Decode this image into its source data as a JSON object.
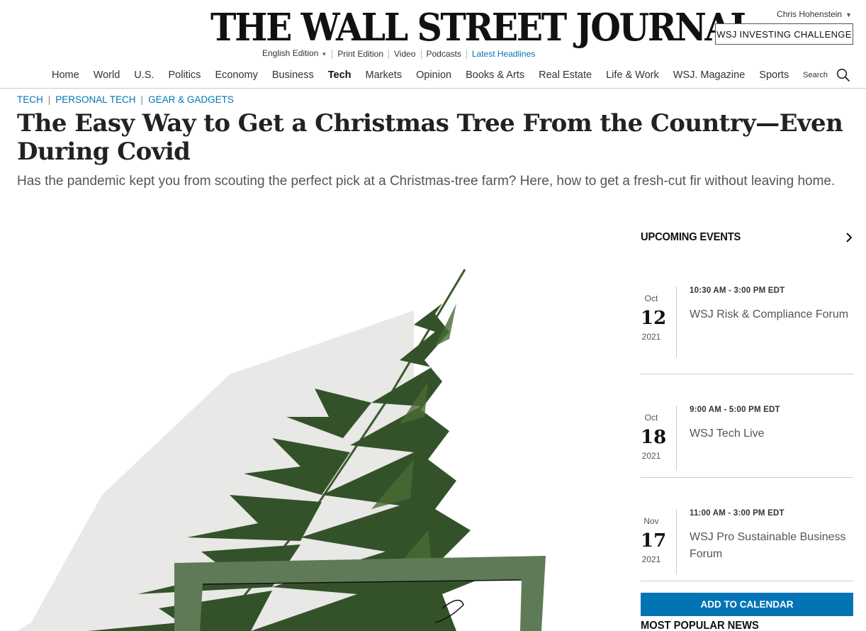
{
  "masthead": {
    "logo": "THE WALL STREET JOURNAL.",
    "user_name": "Chris Hohenstein",
    "challenge_label": "WSJ INVESTING CHALLENGE",
    "subnav": [
      "English Edition",
      "Print Edition",
      "Video",
      "Podcasts",
      "Latest Headlines"
    ]
  },
  "nav": {
    "items": [
      "Home",
      "World",
      "U.S.",
      "Politics",
      "Economy",
      "Business",
      "Tech",
      "Markets",
      "Opinion",
      "Books & Arts",
      "Real Estate",
      "Life & Work",
      "WSJ. Magazine",
      "Sports"
    ],
    "active": "Tech",
    "search_label": "Search"
  },
  "article": {
    "breadcrumbs": [
      "TECH",
      "PERSONAL TECH",
      "GEAR & GADGETS"
    ],
    "headline": "The Easy Way to Get a Christmas Tree From the Country—Even During Covid",
    "dek": "Has the pandemic kept you from scouting the perfect pick at a Christmas-tree farm? Here, how to get a fresh-cut fir without leaving home."
  },
  "rail": {
    "title": "UPCOMING EVENTS",
    "events": [
      {
        "month": "Oct",
        "day": "12",
        "year": "2021",
        "time": "10:30 AM - 3:00 PM EDT",
        "name": "WSJ Risk & Compliance Forum"
      },
      {
        "month": "Oct",
        "day": "18",
        "year": "2021",
        "time": "9:00 AM - 5:00 PM EDT",
        "name": "WSJ Tech Live"
      },
      {
        "month": "Nov",
        "day": "17",
        "year": "2021",
        "time": "11:00 AM - 3:00 PM EDT",
        "name": "WSJ Pro Sustainable Business Forum"
      }
    ],
    "add_to_calendar": "ADD TO CALENDAR",
    "most_popular": "MOST POPULAR NEWS"
  },
  "colors": {
    "accent": "#0274b6",
    "tree": "#3b5a2c",
    "frame": "#5f7a57"
  },
  "icons": [
    "caret-down-icon",
    "search-icon",
    "chevron-right-icon"
  ]
}
